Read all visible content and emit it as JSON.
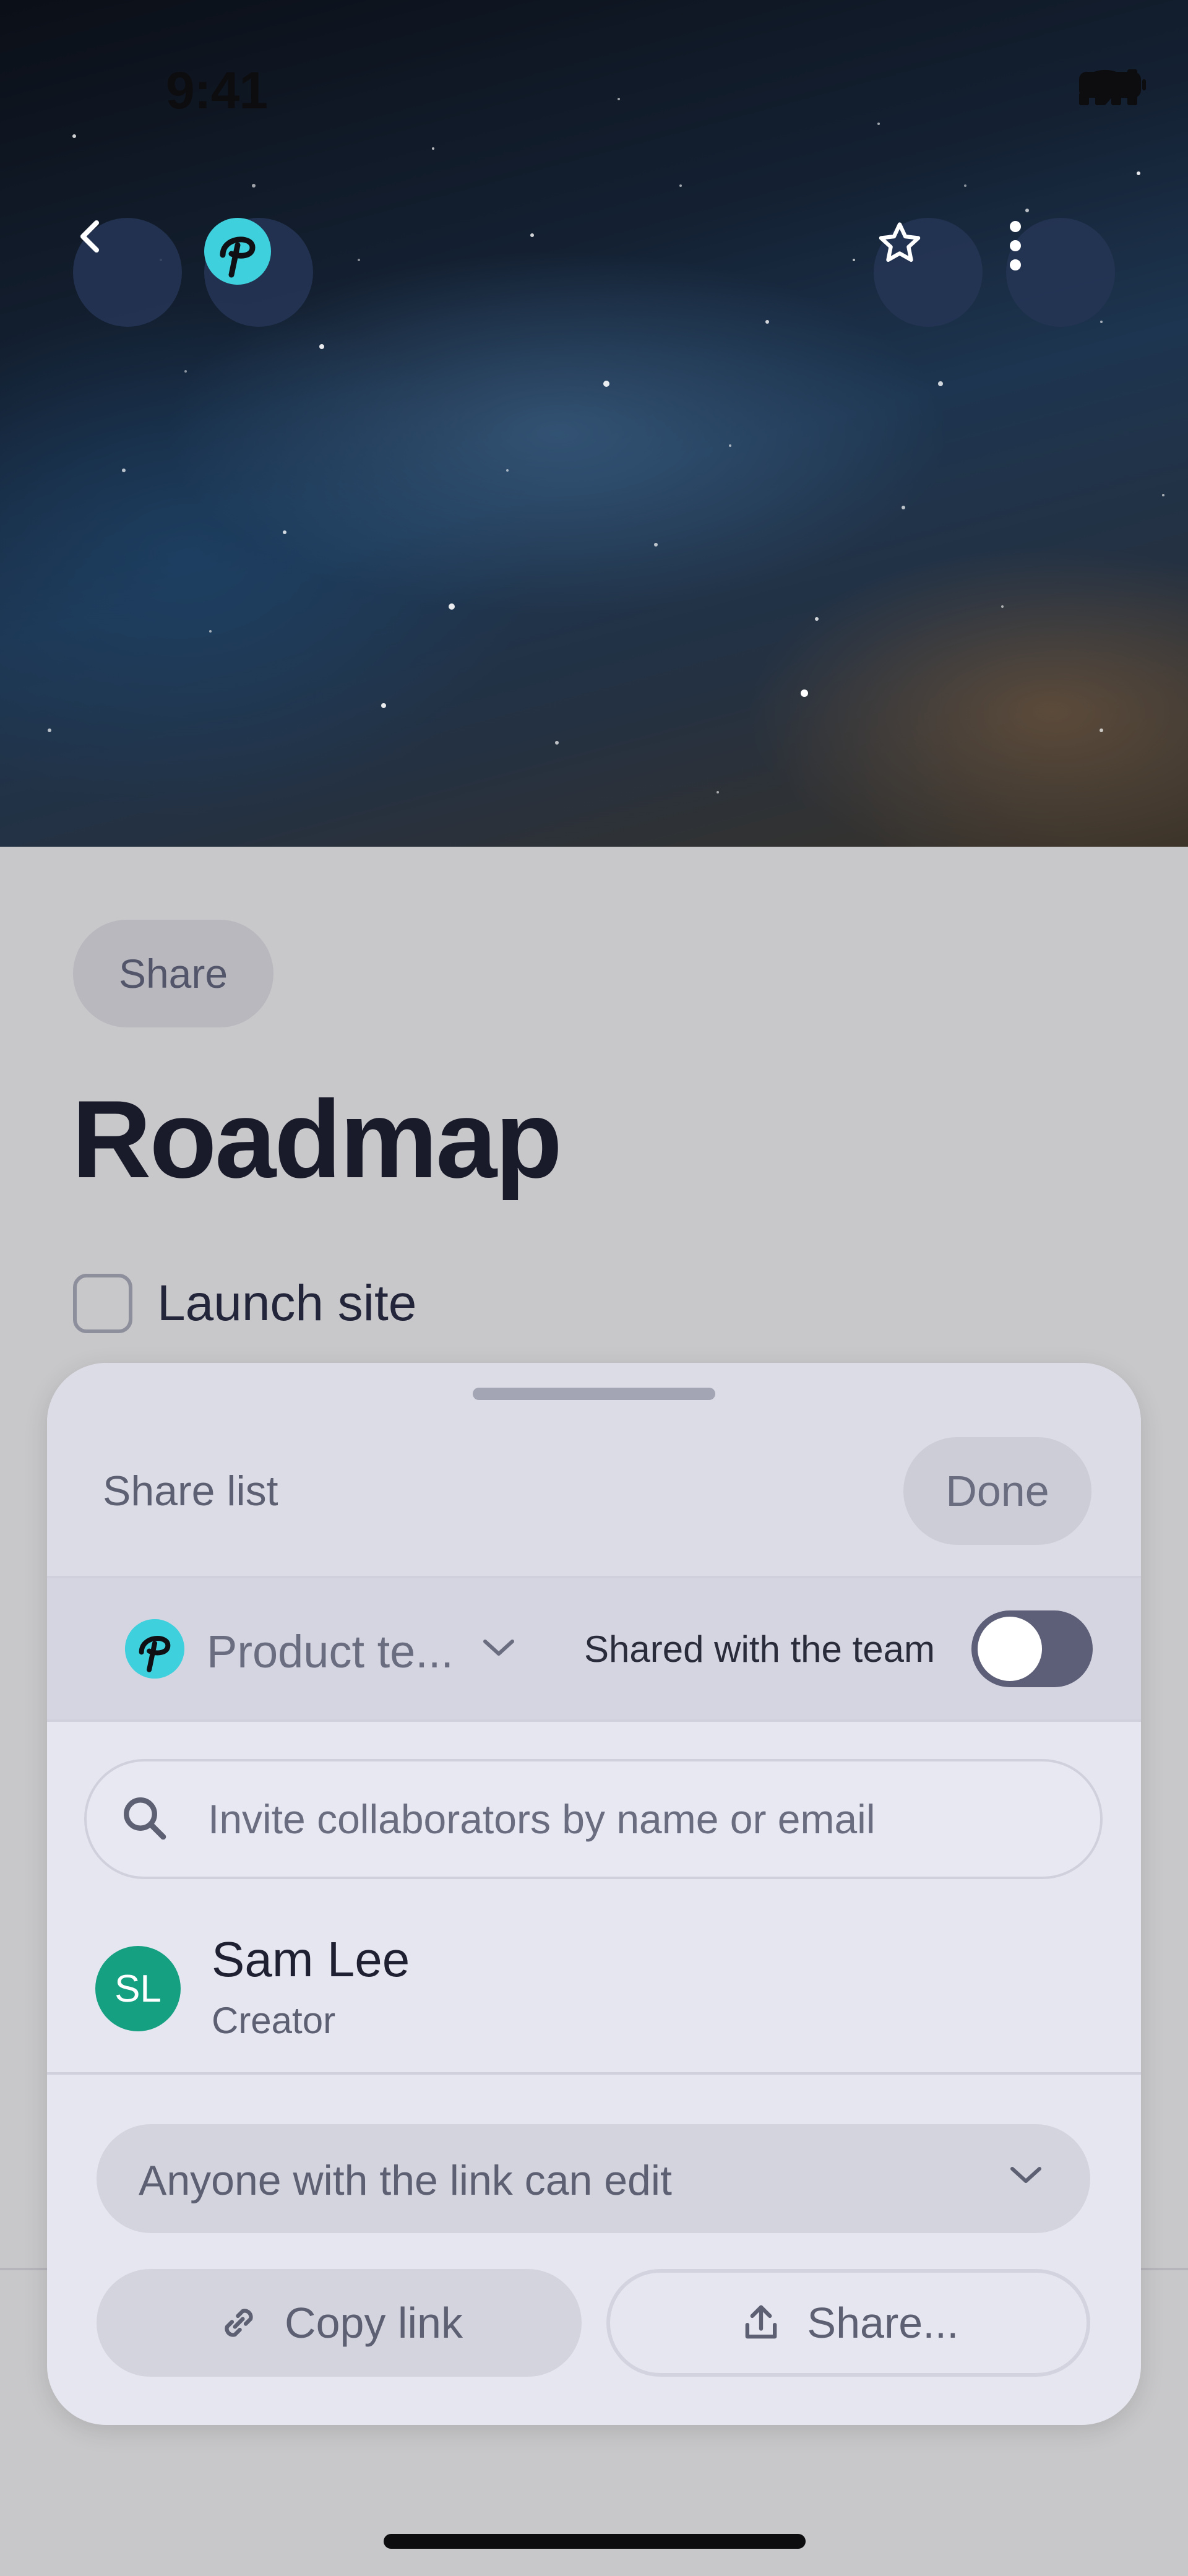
{
  "status_bar": {
    "time": "9:41"
  },
  "page": {
    "chip_label": "Share",
    "title": "Roadmap",
    "tasks": [
      {
        "label": "Launch site",
        "checked": false
      }
    ]
  },
  "share_sheet": {
    "title": "Share list",
    "done_label": "Done",
    "team": {
      "name": "Product te...",
      "shared_label": "Shared with the team",
      "shared_enabled": false
    },
    "search": {
      "placeholder": "Invite collaborators by name or email"
    },
    "members": [
      {
        "initials": "SL",
        "name": "Sam Lee",
        "role": "Creator"
      }
    ],
    "access": {
      "selected": "Anyone with the link can edit"
    },
    "copy_link_label": "Copy link",
    "share_label": "Share..."
  },
  "icons": {
    "back": "chevron-left-icon",
    "app_logo": "app-logo-icon",
    "favorite": "star-icon",
    "more": "more-vertical-icon",
    "search": "search-icon",
    "link": "link-icon",
    "upload": "upload-icon"
  },
  "colors": {
    "avatar": "#14a081",
    "team_logo": "#3fd0dd",
    "toggle_off": "#5d5f78",
    "header_buttons": "#243454"
  }
}
